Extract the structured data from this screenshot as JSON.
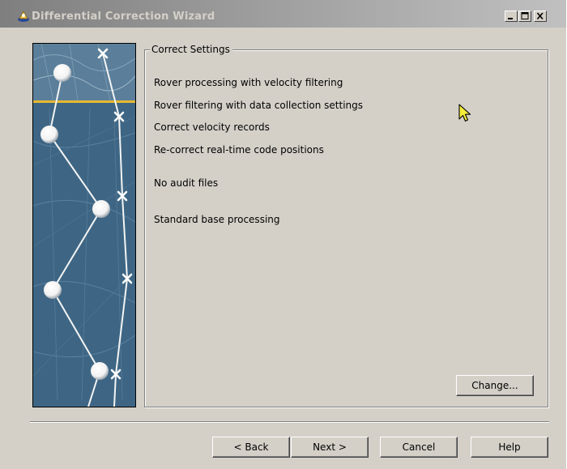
{
  "window": {
    "title": "Differential Correction Wizard",
    "title_icon": "wizard-satellite-icon",
    "controls": [
      "minimize-icon",
      "maximize-icon",
      "close-icon"
    ]
  },
  "group": {
    "legend": "Correct Settings",
    "settings": [
      "Rover processing with velocity filtering",
      "Rover filtering with data collection settings",
      "Correct velocity records",
      "Re-correct real-time code positions",
      "No audit files",
      "Standard base processing"
    ],
    "change_label": "Change..."
  },
  "footer": {
    "back_label": "< Back",
    "next_label": "Next >",
    "cancel_label": "Cancel",
    "help_label": "Help"
  },
  "colors": {
    "titlebar_start": "#7f7f7f",
    "titlebar_end": "#c0c0c0",
    "dialog_face": "#d4d0c8",
    "map_blue": "#3d6583",
    "accent_line": "#e8b830"
  }
}
